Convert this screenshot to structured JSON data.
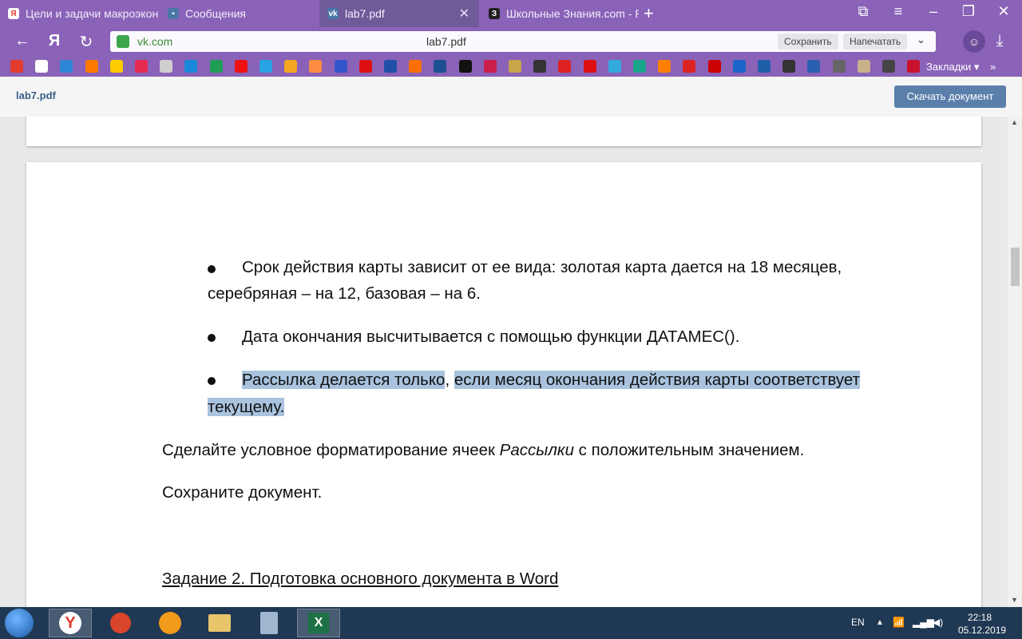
{
  "tabs": [
    {
      "title": "Цели и задачи макроэкон",
      "favicon": "Я",
      "color": "#e23b2e"
    },
    {
      "title": "Сообщения",
      "favicon": "💬",
      "color": "#4a76a8"
    },
    {
      "title": "lab7.pdf",
      "favicon": "vk",
      "color": "#4a76a8"
    },
    {
      "title": "Школьные Знания.com - Р",
      "favicon": "З",
      "color": "#222"
    }
  ],
  "address": {
    "domain": "vk.com",
    "page_title": "lab7.pdf",
    "save_label": "Сохранить",
    "print_label": "Напечатать"
  },
  "bookmarks": {
    "label": "Закладки ▾",
    "more": "»",
    "colors": [
      "#e23b2e",
      "#ffffff",
      "#2f86d6",
      "#ff7a00",
      "#ffcc00",
      "#e52b50",
      "#cfcfcf",
      "#1a88d8",
      "#1f9d55",
      "#e11",
      "#29a3e3",
      "#f5a623",
      "#ff8c42",
      "#3355cc",
      "#d11",
      "#1f4fa8",
      "#ff6f00",
      "#1d4f91",
      "#111",
      "#cc1e4a",
      "#c8a44a",
      "#333",
      "#d22",
      "#d11",
      "#33aadd",
      "#17a589",
      "#ff7f00",
      "#d22",
      "#c00",
      "#1b63c6",
      "#1f5fa8",
      "#333",
      "#2a5fb0",
      "#666",
      "#c9b18a",
      "#444",
      "#c9122d"
    ]
  },
  "viewer": {
    "filename": "lab7.pdf",
    "download_label": "Скачать документ"
  },
  "document": {
    "bullet1_line1": "Срок действия карты зависит от ее вида: золотая карта дается на 18 месяцев,",
    "bullet1_line2": "серебряная – на 12, базовая – на 6.",
    "bullet2": "Дата окончания высчитывается с помощью функции ДАТАМЕС().",
    "bullet3_part1": "Рассылка делается только",
    "bullet3_comma": ",",
    "bullet3_part2": "если месяц окончания действия карты соответствует",
    "bullet3_line2": "текущему.",
    "para1_before": "Сделайте условное форматирование ячеек ",
    "para1_italic": "Рассылки",
    "para1_after": " с положительным значением.",
    "para2": "Сохраните документ.",
    "heading": "Задание 2. Подготовка основного документа в Word"
  },
  "taskbar": {
    "lang": "EN",
    "time": "22:18",
    "date": "05.12.2019"
  }
}
